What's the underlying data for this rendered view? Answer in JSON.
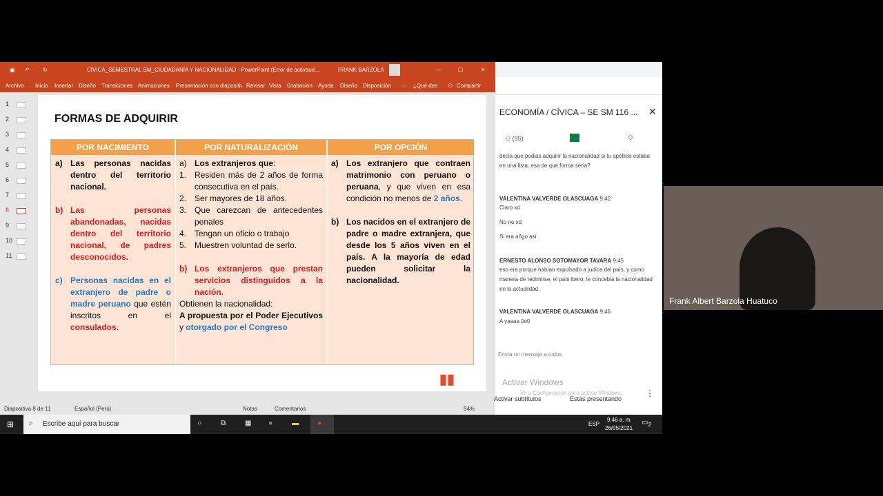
{
  "ppt": {
    "title": "CÍVICA_SEMESTRAL SM_CIUDADANÍA Y NACIONALIDAD - PowerPoint (Error de activació...",
    "user": "FRANK BARZOLA",
    "ribbon": [
      "Archivo",
      "Inicio",
      "Insertar",
      "Diseño",
      "Transiciones",
      "Animaciones",
      "Presentación con diapositivas",
      "Revisar",
      "Vista",
      "Grabación",
      "Ayuda",
      "Diseño",
      "Disposición",
      "¿Qué des",
      "Compartir"
    ],
    "thumbs": [
      "1",
      "2",
      "3",
      "4",
      "5",
      "6",
      "7",
      "8",
      "9",
      "10",
      "11"
    ],
    "slide_title": "FORMAS DE ADQUIRIR",
    "headers": [
      "POR NACIMIENTO",
      "POR NATURALIZACIÓN",
      "POR OPCIÓN"
    ],
    "status": {
      "slide": "Diapositiva 8 de 11",
      "lang": "Español (Perú)",
      "notes": "Notas",
      "comments": "Comentarios",
      "zoom": "94%"
    }
  },
  "col1": {
    "a_m": "a)",
    "a": "Las personas nacidas dentro del territorio nacional.",
    "b_m": "b)",
    "b": "Las personas abandonadas, nacidas dentro del territorio nacional, de padres desconocidos.",
    "c_m": "c)",
    "c1": "Personas nacidas en el extranjero de padre o madre peruano",
    "c2": " que estén inscritos en el ",
    "c3": "consulados",
    "c4": "."
  },
  "col2": {
    "a_m": "a)",
    "a": "Los extranjeros que",
    ":": ":",
    "items": [
      "Residen más de 2 años de forma consecutiva en el país.",
      "Ser mayores de 18 años.",
      "Que carezcan de antecedentes penales",
      "Tengan un oficio o trabajo",
      "Muestren voluntad de serlo."
    ],
    "nums": [
      "1.",
      "2.",
      "3.",
      "4.",
      "5."
    ],
    "b_m": "b)",
    "b": "Los extranjeros que prestan servicios distinguidos a la nación.",
    "obt": "Obtienen la nacionalidad:",
    "p1": "A propuesta por el Poder Ejecutivos",
    "p2": " y ",
    "p3": "otorgado por el Congreso"
  },
  "col3": {
    "a_m": "a)",
    "a1": "Los extranjero que contraen matrimonio con peruano o peruana",
    "a2": ", y que viven en esa condición no menos de ",
    "a3": "2 años",
    "a4": ".",
    "b_m": "b)",
    "b": "Los nacidos en el extranjero de padre o madre extranjera, que desde los 5 años viven en el país. A la mayoría de edad pueden solicitar la nacionalidad."
  },
  "meet": {
    "title": "ECONOMÍA / CÍVICA – SE SM 116 ...",
    "people": "(95)",
    "m0": "decia que podias adquirir la nacionalidad si tu apellido estaba en una lista, esa de que forma seria?",
    "n1": "VALENTINA VALVERDE OLASCUAGA",
    "t1": "9:42",
    "m1a": "Claro xd",
    "m1b": "No no xd",
    "m1c": "Si era añgo asi",
    "n2": "ERNESTO ALONSO SOTOMAYOR TAVARA",
    "t2": "9:45",
    "m2": "eso era porque habían expulsado a judíos del país, y como manera de redimirse, el país ibero, le concebia la nacionalidad en la actualidad",
    "n3": "VALENTINA VALVERDE OLASCUAGA",
    "t3": "9:46",
    "m3": "A yaaaa 0o0",
    "send": "Envía un mensaje a todos",
    "winact": "Activar Windows",
    "winact2": "Ve a Configuración para activar Windows.",
    "subs": "Activar subtítulos",
    "presenting": "Estás presentando"
  },
  "video": {
    "name": "Frank Albert Barzola Huatuco"
  },
  "taskbar": {
    "search": "Escribe aquí para buscar",
    "lang": "ESP",
    "time": "9:46 a. m.",
    "date": "26/05/2021",
    "notif": "2"
  }
}
